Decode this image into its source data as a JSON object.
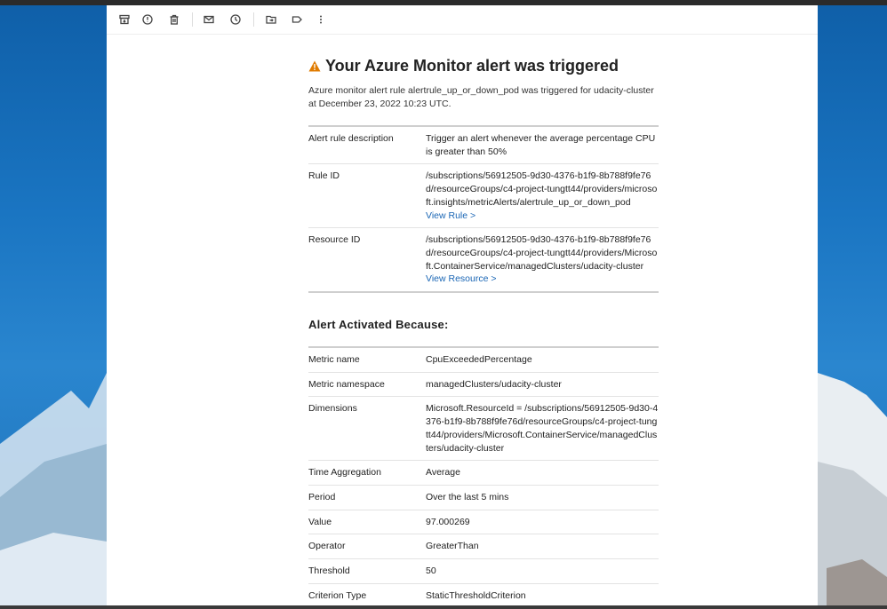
{
  "toolbar": {
    "items": [
      "archive-icon",
      "report-icon",
      "delete-icon",
      "mark-unread-icon",
      "snooze-icon",
      "move-to-icon",
      "label-icon",
      "more-icon"
    ]
  },
  "email": {
    "title": "Your Azure Monitor alert was triggered",
    "intro": "Azure monitor alert rule alertrule_up_or_down_pod was triggered for udacity-cluster at December 23, 2022 10:23 UTC.",
    "rule_table": {
      "rows": [
        {
          "key": "Alert rule description",
          "value": "Trigger an alert whenever the average percentage CPU is greater than 50%"
        },
        {
          "key": "Rule ID",
          "value": "/subscriptions/56912505-9d30-4376-b1f9-8b788f9fe76d/resourceGroups/c4-project-tungtt44/providers/microsoft.insights/metricAlerts/alertrule_up_or_down_pod",
          "link": "View Rule >"
        },
        {
          "key": "Resource ID",
          "value": "/subscriptions/56912505-9d30-4376-b1f9-8b788f9fe76d/resourceGroups/c4-project-tungtt44/providers/Microsoft.ContainerService/managedClusters/udacity-cluster",
          "link": "View Resource >"
        }
      ]
    },
    "section_heading": "Alert Activated Because:",
    "alert_table": {
      "rows": [
        {
          "key": "Metric name",
          "value": "CpuExceededPercentage"
        },
        {
          "key": "Metric namespace",
          "value": "managedClusters/udacity-cluster"
        },
        {
          "key": "Dimensions",
          "value": "Microsoft.ResourceId = /subscriptions/56912505-9d30-4376-b1f9-8b788f9fe76d/resourceGroups/c4-project-tungtt44/providers/Microsoft.ContainerService/managedClusters/udacity-cluster"
        },
        {
          "key": "Time Aggregation",
          "value": "Average"
        },
        {
          "key": "Period",
          "value": "Over the last 5 mins"
        },
        {
          "key": "Value",
          "value": "97.000269"
        },
        {
          "key": "Operator",
          "value": "GreaterThan"
        },
        {
          "key": "Threshold",
          "value": "50"
        },
        {
          "key": "Criterion Type",
          "value": "StaticThresholdCriterion"
        }
      ]
    }
  },
  "colors": {
    "link": "#1a66b5",
    "warning": "#e07b00",
    "wallpaper": "#1f6fb5"
  }
}
